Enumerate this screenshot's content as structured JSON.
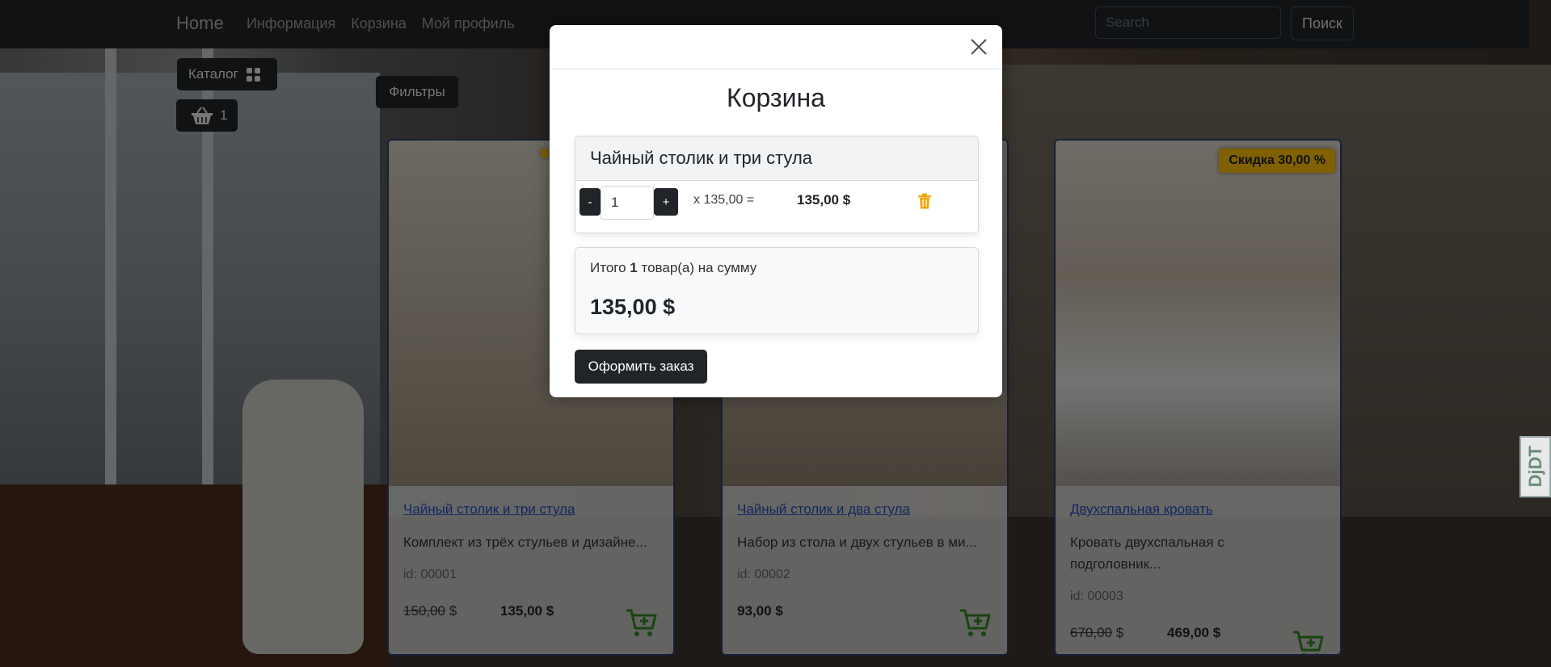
{
  "navbar": {
    "brand": "Home",
    "links": [
      "Информация",
      "Корзина",
      "Мой профиль"
    ],
    "search_placeholder": "Search",
    "search_button": "Поиск"
  },
  "controls": {
    "catalog_label": "Каталог",
    "basket_count": "1",
    "filters_label": "Фильтры"
  },
  "products": [
    {
      "title": "Чайный столик и три стула",
      "description": "Комплект из трёх стульев и дизайне...",
      "id": "id: 00001",
      "old_price": "150,00",
      "old_currency": " $",
      "price": "135,00 $",
      "discount": ""
    },
    {
      "title": "Чайный столик и два стула",
      "description": "Набор из стола и двух стульев в ми...",
      "id": "id: 00002",
      "old_price": "",
      "old_currency": "",
      "price": "93,00 $",
      "discount": ""
    },
    {
      "title": "Двухспальная кровать",
      "description": "Кровать двухспальная с подголовник...",
      "id": "id: 00003",
      "old_price": "670,00",
      "old_currency": " $",
      "price": "469,00 $",
      "discount": "Скидка 30,00 %"
    }
  ],
  "cart_modal": {
    "title": "Корзина",
    "item": {
      "name": "Чайный столик и три стула",
      "minus": "-",
      "plus": "+",
      "quantity": "1",
      "multiplier": "x 135,00 =",
      "line_total": "135,00 $"
    },
    "summary": {
      "prefix": "Итого ",
      "count": "1",
      "suffix": " товар(а) на сумму",
      "total": "135,00 $"
    },
    "order_button": "Оформить заказ"
  },
  "side_tab": "DjDT",
  "colors": {
    "navbar": "#212529",
    "accent_badge": "#ffc107",
    "link": "#1e4fbf",
    "cart_icon": "#2e8b1f",
    "trash_icon": "#f0a500"
  }
}
